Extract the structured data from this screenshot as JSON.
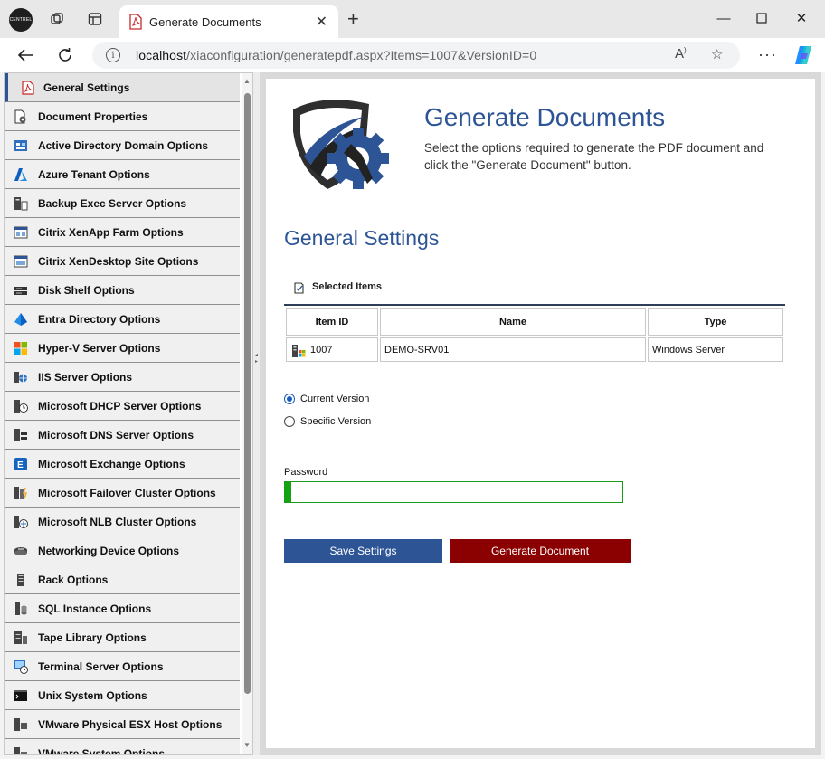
{
  "browser": {
    "profile_label": "CENTREL",
    "tab_title": "Generate Documents",
    "url_host": "localhost",
    "url_path": "/xiaconfiguration/generatepdf.aspx?Items=1007&VersionID=0",
    "icons": [
      "workspaces-icon",
      "tab-actions-icon",
      "back-icon",
      "refresh-icon",
      "info-icon",
      "read-aloud-icon",
      "favorite-icon",
      "more-icon",
      "copilot-icon"
    ]
  },
  "sidebar": {
    "items": [
      {
        "label": "General Settings",
        "icon": "pdf-icon",
        "active": true
      },
      {
        "label": "Document Properties",
        "icon": "document-gear-icon"
      },
      {
        "label": "Active Directory Domain Options",
        "icon": "active-directory-icon"
      },
      {
        "label": "Azure Tenant Options",
        "icon": "azure-icon"
      },
      {
        "label": "Backup Exec Server Options",
        "icon": "backup-server-icon"
      },
      {
        "label": "Citrix XenApp Farm Options",
        "icon": "citrix-xenapp-icon"
      },
      {
        "label": "Citrix XenDesktop Site Options",
        "icon": "citrix-xendesktop-icon"
      },
      {
        "label": "Disk Shelf Options",
        "icon": "disk-shelf-icon"
      },
      {
        "label": "Entra Directory Options",
        "icon": "entra-icon"
      },
      {
        "label": "Hyper-V Server Options",
        "icon": "hyperv-icon"
      },
      {
        "label": "IIS Server Options",
        "icon": "iis-icon"
      },
      {
        "label": "Microsoft DHCP Server Options",
        "icon": "dhcp-icon"
      },
      {
        "label": "Microsoft DNS Server Options",
        "icon": "dns-icon"
      },
      {
        "label": "Microsoft Exchange Options",
        "icon": "exchange-icon"
      },
      {
        "label": "Microsoft Failover Cluster Options",
        "icon": "failover-cluster-icon"
      },
      {
        "label": "Microsoft NLB Cluster Options",
        "icon": "nlb-cluster-icon"
      },
      {
        "label": "Networking Device Options",
        "icon": "network-device-icon"
      },
      {
        "label": "Rack Options",
        "icon": "rack-icon"
      },
      {
        "label": "SQL Instance Options",
        "icon": "sql-icon"
      },
      {
        "label": "Tape Library Options",
        "icon": "tape-library-icon"
      },
      {
        "label": "Terminal Server Options",
        "icon": "terminal-server-icon"
      },
      {
        "label": "Unix System Options",
        "icon": "unix-icon"
      },
      {
        "label": "VMware Physical ESX Host Options",
        "icon": "vmware-esx-icon"
      },
      {
        "label": "VMware System Options",
        "icon": "vmware-system-icon"
      }
    ]
  },
  "main": {
    "title": "Generate Documents",
    "description": "Select the options required to generate the PDF document and click the \"Generate Document\" button.",
    "section_title": "General Settings",
    "selected_items_label": "Selected Items",
    "table": {
      "headers": [
        "Item ID",
        "Name",
        "Type"
      ],
      "rows": [
        {
          "id": "1007",
          "name": "DEMO-SRV01",
          "type": "Windows Server"
        }
      ]
    },
    "version_options": [
      {
        "label": "Current Version",
        "checked": true
      },
      {
        "label": "Specific Version",
        "checked": false
      }
    ],
    "password_label": "Password",
    "password_value": "",
    "password_strength": 0.02,
    "save_button": "Save Settings",
    "generate_button": "Generate Document"
  },
  "colors": {
    "accent": "#2d5596",
    "generate": "#8b0000",
    "strength": "#13a313"
  }
}
